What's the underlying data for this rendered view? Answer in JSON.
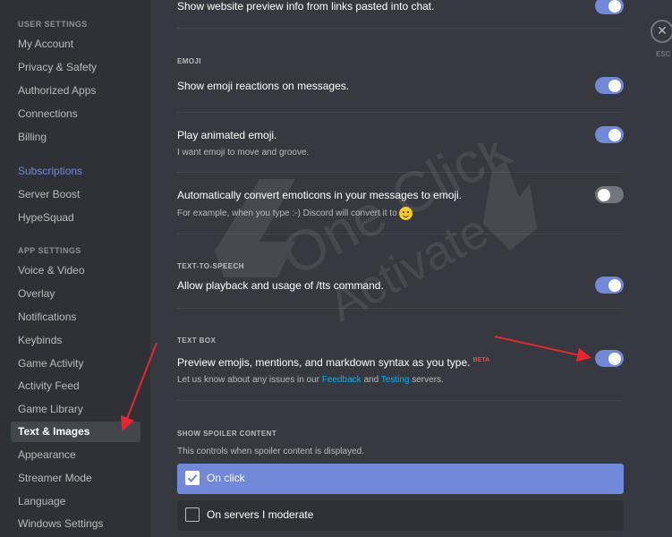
{
  "sidebar": {
    "user_settings_header": "USER SETTINGS",
    "user_items": [
      "My Account",
      "Privacy & Safety",
      "Authorized Apps",
      "Connections",
      "Billing"
    ],
    "subscriptions": "Subscriptions",
    "sub_items": [
      "Server Boost",
      "HypeSquad"
    ],
    "app_settings_header": "APP SETTINGS",
    "app_items": [
      "Voice & Video",
      "Overlay",
      "Notifications",
      "Keybinds",
      "Game Activity",
      "Activity Feed",
      "Game Library",
      "Text & Images",
      "Appearance",
      "Streamer Mode",
      "Language",
      "Windows Settings"
    ],
    "active_item": "Text & Images"
  },
  "content": {
    "link_preview": {
      "title": "Show website preview info from links pasted into chat.",
      "enabled": true
    },
    "emoji_header": "EMOJI",
    "emoji_reactions": {
      "title": "Show emoji reactions on messages.",
      "enabled": true
    },
    "animated_emoji": {
      "title": "Play animated emoji.",
      "desc": "I want emoji to move and groove.",
      "enabled": true
    },
    "emoticons": {
      "title": "Automatically convert emoticons in your messages to emoji.",
      "desc": "For example, when you type :-) Discord will convert it to",
      "enabled": false
    },
    "tts_header": "TEXT-TO-SPEECH",
    "tts": {
      "title": "Allow playback and usage of /tts command.",
      "enabled": true
    },
    "textbox_header": "TEXT BOX",
    "textbox_preview": {
      "title": "Preview emojis, mentions, and markdown syntax as you type.",
      "beta": "BETA",
      "desc_prefix": "Let us know about any issues in our",
      "feedback_link": "Feedback",
      "desc_and": "and",
      "testing_link": "Testing",
      "desc_suffix": "servers.",
      "enabled": true
    },
    "spoiler_header": "SHOW SPOILER CONTENT",
    "spoiler_desc": "This controls when spoiler content is displayed.",
    "spoiler_options": [
      "On click",
      "On servers I moderate"
    ],
    "spoiler_selected": "On click"
  },
  "esc": {
    "icon": "close-icon",
    "label": "ESC"
  },
  "watermark": {
    "line1": "One Click",
    "line2": "Activate"
  },
  "colors": {
    "accent": "#7289da",
    "annotation_arrow": "#e8262d"
  }
}
